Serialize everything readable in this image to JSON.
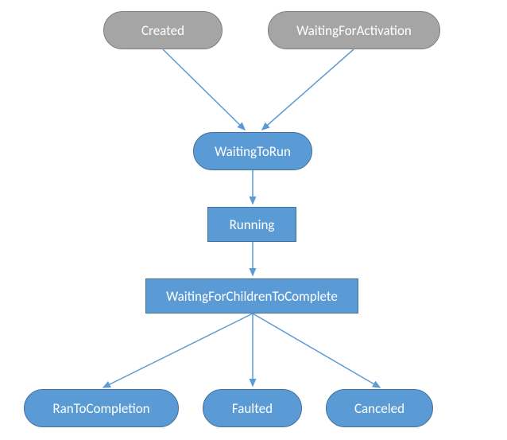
{
  "nodes": {
    "created": {
      "label": "Created"
    },
    "waitingForActivation": {
      "label": "WaitingForActivation"
    },
    "waitingToRun": {
      "label": "WaitingToRun"
    },
    "running": {
      "label": "Running"
    },
    "waitingForChildren": {
      "label": "WaitingForChildrenToComplete"
    },
    "ranToCompletion": {
      "label": "RanToCompletion"
    },
    "faulted": {
      "label": "Faulted"
    },
    "canceled": {
      "label": "Canceled"
    }
  },
  "edges": [
    {
      "from": "created",
      "to": "waitingToRun"
    },
    {
      "from": "waitingForActivation",
      "to": "waitingToRun"
    },
    {
      "from": "waitingToRun",
      "to": "running"
    },
    {
      "from": "running",
      "to": "waitingForChildren"
    },
    {
      "from": "waitingForChildren",
      "to": "ranToCompletion"
    },
    {
      "from": "waitingForChildren",
      "to": "faulted"
    },
    {
      "from": "waitingForChildren",
      "to": "canceled"
    }
  ],
  "colors": {
    "gray": "#a5a5a5",
    "blue": "#5b9bd5",
    "edgeColor": "#5b9bd5"
  }
}
